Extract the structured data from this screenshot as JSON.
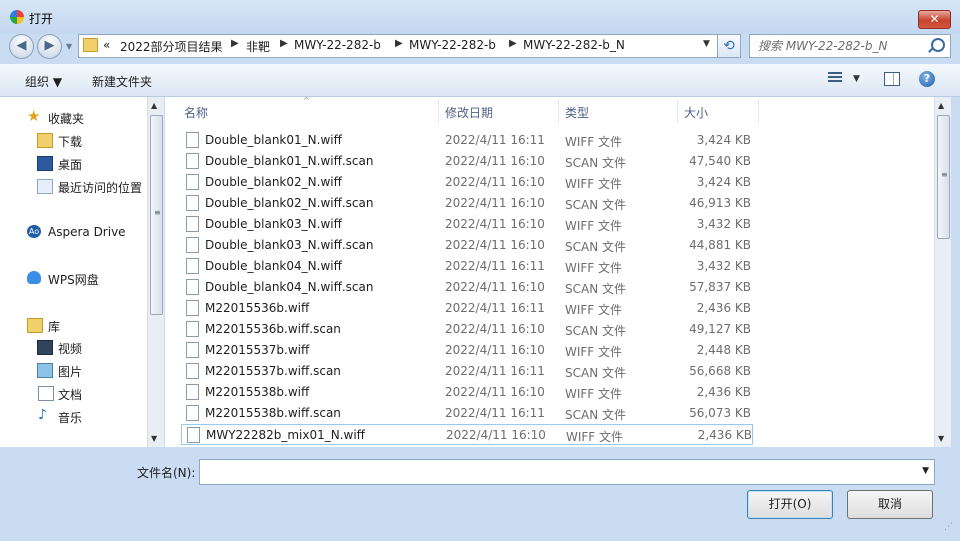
{
  "window": {
    "title": "打开",
    "close_glyph": "✕"
  },
  "nav": {
    "back_glyph": "◀",
    "forward_glyph": "▶"
  },
  "address": {
    "overflow": "«",
    "segments": [
      "2022部分项目结果",
      "非靶",
      "MWY-22-282-b",
      "MWY-22-282-b",
      "MWY-22-282-b_N"
    ],
    "separator": "▶",
    "dropdown_glyph": "▼",
    "refresh_glyph": "⟲"
  },
  "search": {
    "placeholder": "搜索 MWY-22-282-b_N"
  },
  "toolbar": {
    "organize": "组织 ▼",
    "new_folder": "新建文件夹",
    "view_dropdown": "▼",
    "help": "?"
  },
  "sidebar": {
    "favorites": {
      "label": "收藏夹",
      "icon": "star-icon"
    },
    "favorites_items": [
      {
        "label": "下载",
        "icon": "download-folder-icon"
      },
      {
        "label": "桌面",
        "icon": "desktop-icon"
      },
      {
        "label": "最近访问的位置",
        "icon": "recent-places-icon"
      }
    ],
    "aspera": {
      "label": "Aspera Drive",
      "icon": "aspera-icon",
      "glyph": "Ao"
    },
    "wps": {
      "label": "WPS网盘",
      "icon": "cloud-icon"
    },
    "libraries": {
      "label": "库",
      "icon": "library-icon"
    },
    "library_items": [
      {
        "label": "视频",
        "icon": "video-icon"
      },
      {
        "label": "图片",
        "icon": "picture-icon"
      },
      {
        "label": "文档",
        "icon": "document-icon"
      },
      {
        "label": "音乐",
        "icon": "music-icon",
        "glyph": "♪"
      }
    ]
  },
  "scroll": {
    "up": "▲",
    "down": "▼",
    "grip": "≡"
  },
  "filelist": {
    "columns": [
      "名称",
      "修改日期",
      "类型",
      "大小"
    ],
    "sort_indicator": "^",
    "rows": [
      {
        "name": "Double_blank01_N.wiff",
        "date": "2022/4/11 16:11",
        "type": "WIFF 文件",
        "size": "3,424 KB"
      },
      {
        "name": "Double_blank01_N.wiff.scan",
        "date": "2022/4/11 16:10",
        "type": "SCAN 文件",
        "size": "47,540 KB"
      },
      {
        "name": "Double_blank02_N.wiff",
        "date": "2022/4/11 16:10",
        "type": "WIFF 文件",
        "size": "3,424 KB"
      },
      {
        "name": "Double_blank02_N.wiff.scan",
        "date": "2022/4/11 16:10",
        "type": "SCAN 文件",
        "size": "46,913 KB"
      },
      {
        "name": "Double_blank03_N.wiff",
        "date": "2022/4/11 16:10",
        "type": "WIFF 文件",
        "size": "3,432 KB"
      },
      {
        "name": "Double_blank03_N.wiff.scan",
        "date": "2022/4/11 16:10",
        "type": "SCAN 文件",
        "size": "44,881 KB"
      },
      {
        "name": "Double_blank04_N.wiff",
        "date": "2022/4/11 16:11",
        "type": "WIFF 文件",
        "size": "3,432 KB"
      },
      {
        "name": "Double_blank04_N.wiff.scan",
        "date": "2022/4/11 16:10",
        "type": "SCAN 文件",
        "size": "57,837 KB"
      },
      {
        "name": "M22015536b.wiff",
        "date": "2022/4/11 16:11",
        "type": "WIFF 文件",
        "size": "2,436 KB"
      },
      {
        "name": "M22015536b.wiff.scan",
        "date": "2022/4/11 16:10",
        "type": "SCAN 文件",
        "size": "49,127 KB"
      },
      {
        "name": "M22015537b.wiff",
        "date": "2022/4/11 16:10",
        "type": "WIFF 文件",
        "size": "2,448 KB"
      },
      {
        "name": "M22015537b.wiff.scan",
        "date": "2022/4/11 16:11",
        "type": "SCAN 文件",
        "size": "56,668 KB"
      },
      {
        "name": "M22015538b.wiff",
        "date": "2022/4/11 16:10",
        "type": "WIFF 文件",
        "size": "2,436 KB"
      },
      {
        "name": "M22015538b.wiff.scan",
        "date": "2022/4/11 16:11",
        "type": "SCAN 文件",
        "size": "56,073 KB"
      },
      {
        "name": "MWY22282b_mix01_N.wiff",
        "date": "2022/4/11 16:10",
        "type": "WIFF 文件",
        "size": "2,436 KB"
      }
    ]
  },
  "footer": {
    "filename_label": "文件名(N):",
    "filename_value": "",
    "filename_dropdown": "▼",
    "open_button": "打开(O)",
    "cancel_button": "取消",
    "resize_grip": "⋰"
  }
}
